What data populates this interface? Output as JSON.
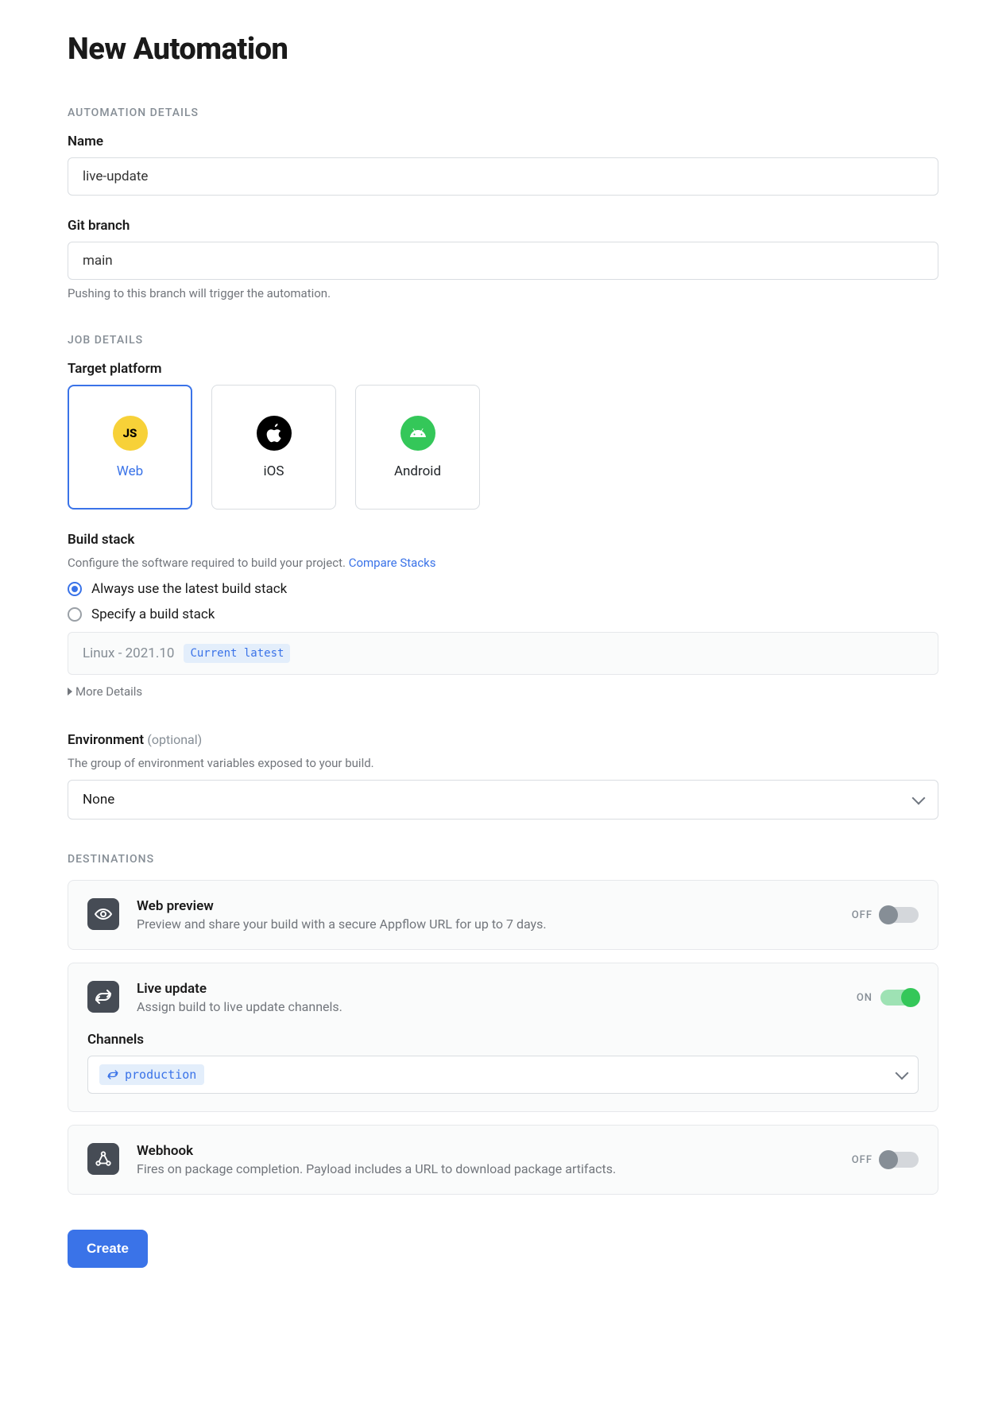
{
  "page_title": "New Automation",
  "sections": {
    "automation_details": "Automation Details",
    "job_details": "Job Details",
    "destinations": "Destinations"
  },
  "fields": {
    "name": {
      "label": "Name",
      "value": "live-update"
    },
    "git_branch": {
      "label": "Git branch",
      "value": "main",
      "helper": "Pushing to this branch will trigger the automation."
    },
    "target_platform": {
      "label": "Target platform",
      "options": [
        {
          "id": "web",
          "label": "Web",
          "selected": true
        },
        {
          "id": "ios",
          "label": "iOS",
          "selected": false
        },
        {
          "id": "android",
          "label": "Android",
          "selected": false
        }
      ]
    },
    "build_stack": {
      "label": "Build stack",
      "helper": "Configure the software required to build your project.",
      "compare_link": "Compare Stacks",
      "radios": {
        "latest": "Always use the latest build stack",
        "specify": "Specify a build stack"
      },
      "selected": "latest",
      "current_name": "Linux - 2021.10",
      "current_badge": "Current latest",
      "more_details": "More Details"
    },
    "environment": {
      "label": "Environment",
      "optional_text": "(optional)",
      "helper": "The group of environment variables exposed to your build.",
      "value": "None"
    }
  },
  "destinations": [
    {
      "id": "web-preview",
      "title": "Web preview",
      "desc": "Preview and share your build with a secure Appflow URL for up to 7 days.",
      "enabled": false,
      "state_label": "OFF"
    },
    {
      "id": "live-update",
      "title": "Live update",
      "desc": "Assign build to live update channels.",
      "enabled": true,
      "state_label": "ON",
      "channels_label": "Channels",
      "channels": [
        "production"
      ]
    },
    {
      "id": "webhook",
      "title": "Webhook",
      "desc": "Fires on package completion. Payload includes a URL to download package artifacts.",
      "enabled": false,
      "state_label": "OFF"
    }
  ],
  "actions": {
    "create": "Create"
  },
  "icons": {
    "js_text": "JS"
  }
}
